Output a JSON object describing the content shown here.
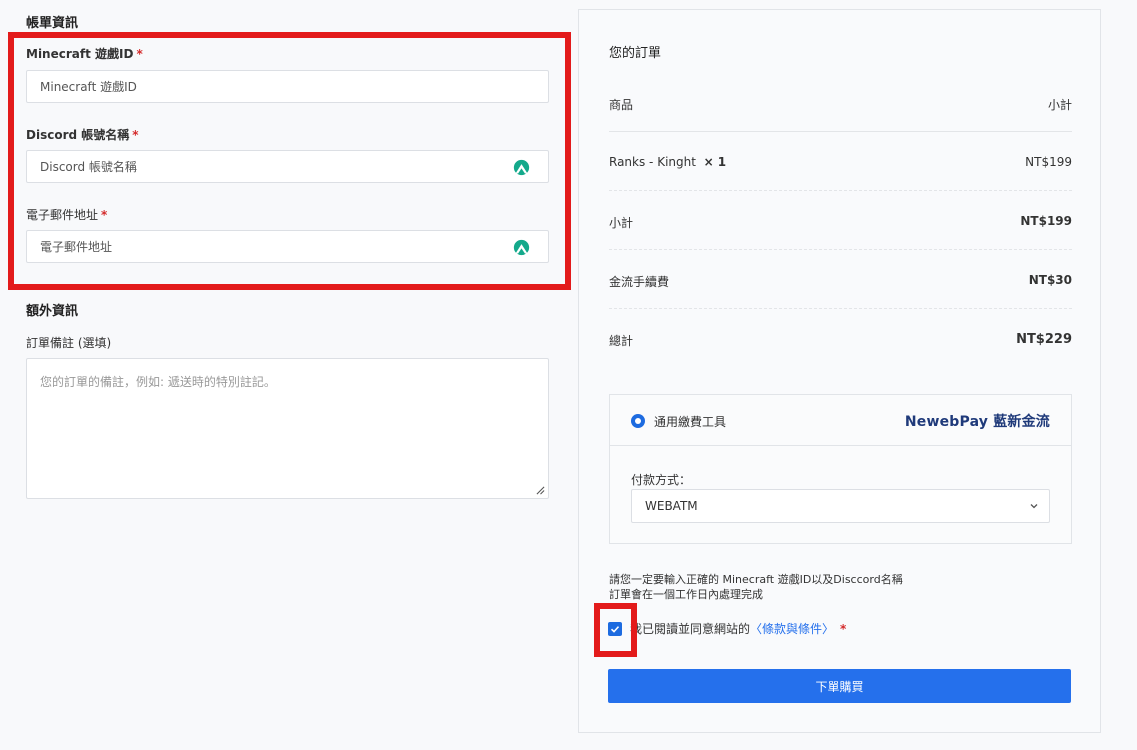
{
  "billing": {
    "title": "帳單資訊",
    "minecraft_label": "Minecraft 遊戲ID",
    "minecraft_placeholder": "Minecraft 遊戲ID",
    "discord_label": "Discord 帳號名稱",
    "discord_placeholder": "Discord 帳號名稱",
    "email_label": "電子郵件地址",
    "email_placeholder": "電子郵件地址",
    "required_mark": "*"
  },
  "extra": {
    "title": "額外資訊",
    "notes_label": "訂單備註 (選填)",
    "notes_placeholder": "您的訂單的備註，例如: 遞送時的特別註記。"
  },
  "order": {
    "title": "您的訂單",
    "col_product": "商品",
    "col_subtotal": "小計",
    "item_name": "Ranks - Kinght",
    "item_qty": "× 1",
    "item_price": "NT$199",
    "subtotal_label": "小計",
    "subtotal_value": "NT$199",
    "fee_label": "金流手續費",
    "fee_value": "NT$30",
    "total_label": "總計",
    "total_value": "NT$229"
  },
  "payment": {
    "method_name": "通用繳費工具",
    "provider_logo": "NewebPay 藍新金流",
    "method_label": "付款方式：",
    "selected_option": "WEBATM"
  },
  "notice": {
    "line1": "請您一定要輸入正確的 Minecraft 遊戲ID以及Disccord名稱",
    "line2": "訂單會在一個工作日內處理完成"
  },
  "terms": {
    "prefix": "我已閱讀並同意網站的",
    "link": "〈條款與條件〉",
    "required_mark": "*",
    "checked": true
  },
  "submit_label": "下單購買",
  "colors": {
    "accent": "#2570ec",
    "annotation_red": "#e31b1b",
    "autofill_icon": "#14a98b"
  }
}
